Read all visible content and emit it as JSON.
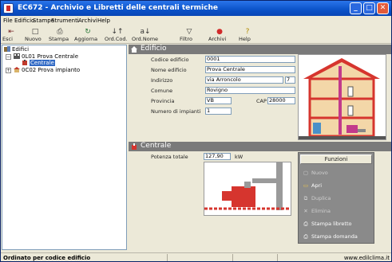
{
  "window": {
    "title": "EC672 - Archivio e Libretti delle centrali termiche",
    "controls": {
      "minimize": "_",
      "maximize": "□",
      "close": "✕"
    }
  },
  "menu": [
    "File",
    "Edificio",
    "Stampe",
    "Strumenti",
    "Archivi",
    "Help"
  ],
  "toolbar": [
    {
      "label": "Esci",
      "icon": "exit-icon",
      "glyph": "⇤"
    },
    {
      "label": "Nuovo",
      "icon": "new-icon",
      "glyph": "□"
    },
    {
      "label": "Stampa",
      "icon": "print-icon",
      "glyph": "⎙"
    },
    {
      "label": "Aggiorna",
      "icon": "refresh-icon",
      "glyph": "↻"
    },
    {
      "label": "Ord.Cod.",
      "icon": "sort-code-icon",
      "glyph": "↓↑"
    },
    {
      "label": "Ord.Nome",
      "icon": "sort-name-icon",
      "glyph": "a↓"
    },
    {
      "label": "Filtro",
      "icon": "filter-icon",
      "glyph": "▽"
    },
    {
      "label": "Archivi",
      "icon": "archive-icon",
      "glyph": "●"
    },
    {
      "label": "Help",
      "icon": "help-icon",
      "glyph": "?"
    }
  ],
  "tree": {
    "root": "Edifici",
    "items": [
      {
        "code": "0L01",
        "name": "Prova Centrale"
      },
      {
        "child": "Centrale"
      },
      {
        "code": "0C02",
        "name": "Prova impianto"
      }
    ]
  },
  "edificio": {
    "heading": "Edificio",
    "fields": {
      "codice_label": "Codice edificio",
      "codice_value": "0001",
      "nome_label": "Nome edificio",
      "nome_value": "Prova Centrale",
      "indirizzo_label": "Indirizzo",
      "indirizzo_value": "via Arroncolo",
      "civico_value": "7",
      "comune_label": "Comune",
      "comune_value": "Rovigno",
      "provincia_label": "Provincia",
      "provincia_value": "VB",
      "cap_label": "CAP",
      "cap_value": "28000",
      "impianti_label": "Numero di impianti",
      "impianti_value": "1"
    }
  },
  "centrale": {
    "heading": "Centrale",
    "potenza_label": "Potenza totale",
    "potenza_value": "127,90",
    "potenza_unit": "kW"
  },
  "funzioni": {
    "heading": "Funzioni",
    "items": [
      {
        "label": "Nuovo",
        "enabled": false,
        "icon": "new-doc-icon",
        "glyph": "▢"
      },
      {
        "label": "Apri",
        "enabled": true,
        "icon": "open-folder-icon",
        "glyph": "▭"
      },
      {
        "label": "Duplica",
        "enabled": false,
        "icon": "duplicate-icon",
        "glyph": "⧉"
      },
      {
        "label": "Elimina",
        "enabled": false,
        "icon": "delete-icon",
        "glyph": "✕"
      },
      {
        "label": "Stampa libretto",
        "enabled": true,
        "icon": "print-booklet-icon",
        "glyph": "⎙"
      },
      {
        "label": "Stampa domanda",
        "enabled": true,
        "icon": "print-request-icon",
        "glyph": "⎙"
      }
    ]
  },
  "status": {
    "left": "Ordinato per codice edificio",
    "right": "www.edilclima.it"
  },
  "colors": {
    "titlebar": "#0a52c8",
    "section_header": "#7a7a7a",
    "selection": "#316ac5",
    "house_wall": "#d6352e"
  }
}
